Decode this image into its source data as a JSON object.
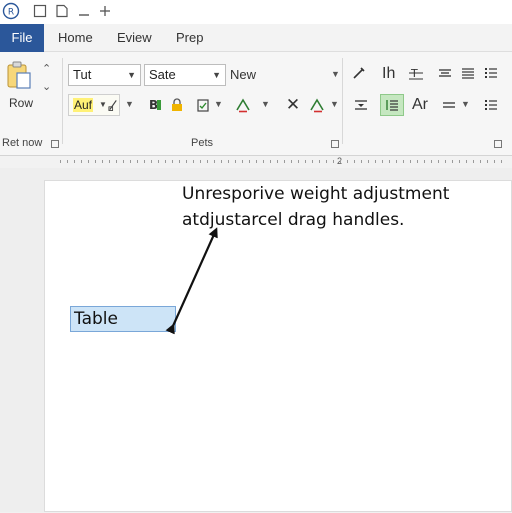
{
  "titlebar": {
    "quick_access": [
      "app-icon",
      "new-document-icon",
      "open-document-icon",
      "minimize-icon",
      "add-icon"
    ]
  },
  "tabs": [
    {
      "label": "File"
    },
    {
      "label": "Home"
    },
    {
      "label": "Eview"
    },
    {
      "label": "Prep"
    }
  ],
  "ribbon": {
    "clipboard": {
      "paste_label": "Row",
      "group_label": "Ret now"
    },
    "font": {
      "font_name": "Tut",
      "font_size": "Sate",
      "new_label": "New",
      "style_label": "Auf",
      "group_label": "Pets"
    },
    "paragraph": {
      "heading_label": "Ih",
      "text_direction_label": "Ar"
    }
  },
  "ruler": {
    "marker": "2"
  },
  "document": {
    "annotation_line1": "Unresporive weight adjustment",
    "annotation_line2": "atdjustarcel drag handles.",
    "table_cell": "Table"
  },
  "colors": {
    "file_tab": "#2b579a",
    "selected_cell": "#cde4f7",
    "active_button": "#c5e7c0"
  }
}
